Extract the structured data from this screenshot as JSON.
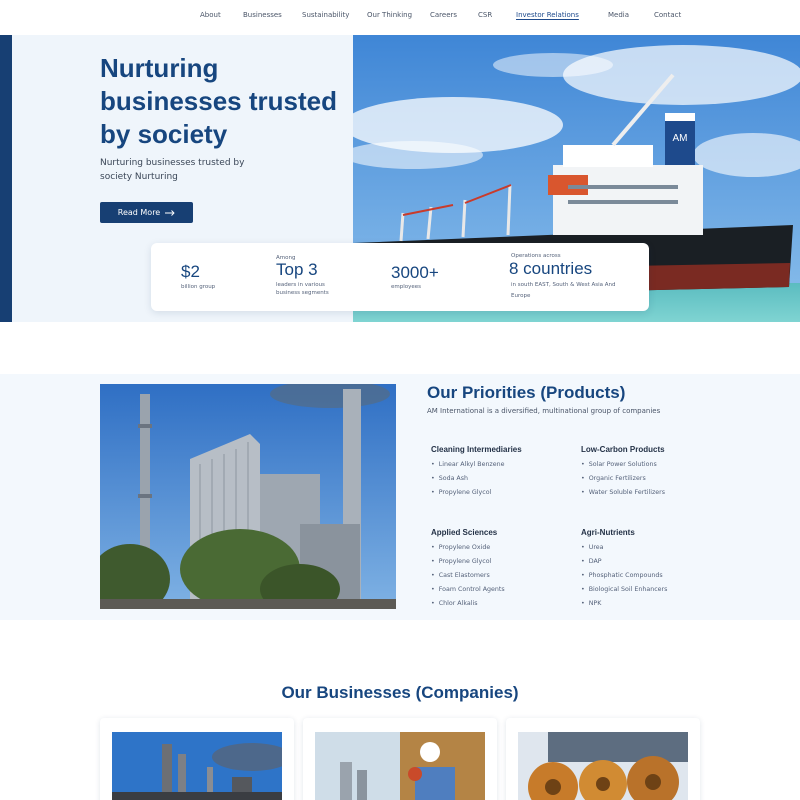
{
  "nav": {
    "items": [
      {
        "label": "About"
      },
      {
        "label": "Businesses"
      },
      {
        "label": "Sustainability"
      },
      {
        "label": "Our Thinking"
      },
      {
        "label": "Careers"
      },
      {
        "label": "CSR"
      },
      {
        "label": "Investor Relations",
        "active": true
      },
      {
        "label": "Media"
      },
      {
        "label": "Contact"
      }
    ]
  },
  "hero": {
    "title": "Nurturing businesses trusted by society",
    "subtitle": "Nurturing businesses trusted by society Nurturing",
    "cta_label": "Read More",
    "cta_icon": "arrow-right-icon",
    "ship_logo": "AM"
  },
  "stats": {
    "s1": {
      "value": "$2",
      "caption": "billion group"
    },
    "s2": {
      "prefix": "Among",
      "value": "Top 3",
      "caption": "leaders in various business segments"
    },
    "s3": {
      "value": "3000+",
      "caption": "employees"
    },
    "s4": {
      "prefix": "Operations across",
      "value": "8 countries",
      "caption": "in south EAST, South & West Asia And Europe"
    }
  },
  "priorities": {
    "title": "Our Priorities (Products)",
    "subtitle": "AM International is a diversified, multinational group of companies",
    "categories": [
      {
        "title": "Cleaning Intermediaries",
        "items": [
          "Linear Alkyl Benzene",
          "Soda Ash",
          "Propylene Glycol"
        ]
      },
      {
        "title": "Low-Carbon Products",
        "items": [
          "Solar Power Solutions",
          "Organic Fertilizers",
          "Water Soluble Fertilizers"
        ]
      },
      {
        "title": "Applied Sciences",
        "items": [
          "Propylene Oxide",
          "Propylene Glycol",
          "Cast Elastomers",
          "Foam Control Agents",
          "Chlor Alkalis"
        ]
      },
      {
        "title": "Agri-Nutrients",
        "items": [
          "Urea",
          "DAP",
          "Phosphatic Compounds",
          "Biological Soil Enhancers",
          "NPK"
        ]
      }
    ]
  },
  "businesses": {
    "title": "Our Businesses (Companies)"
  },
  "colors": {
    "brand": "#17467f",
    "hero_bg": "#eff5fb",
    "accent_bar": "#173f73"
  }
}
